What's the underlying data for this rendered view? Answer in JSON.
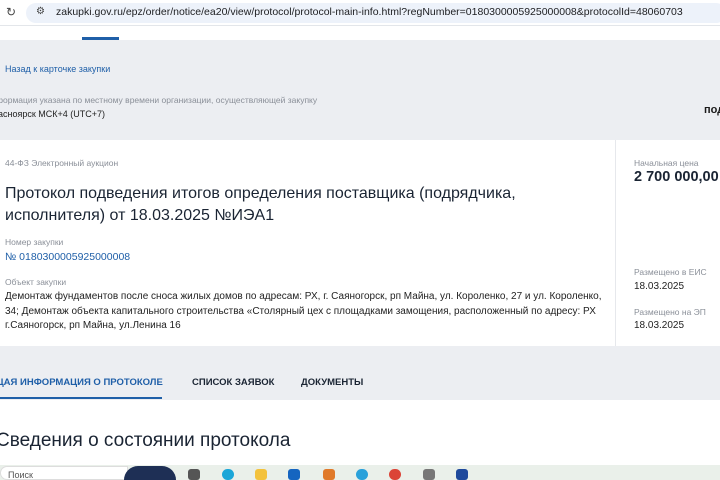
{
  "browser": {
    "url": "zakupki.gov.ru/epz/order/notice/ea20/view/protocol/protocol-main-info.html?regNumber=0180300005925000008&protocolId=48060703"
  },
  "header": {
    "back_link": "Назад к карточке закупки",
    "tz_note": "формация указана по местному времени организации, осуществляющей закупку",
    "tz": "асноярск МСК+4 (UTC+7)",
    "right_cut": "под"
  },
  "card": {
    "law": "44-ФЗ  Электронный аукцион",
    "title": "Протокол подведения итогов определения поставщика (подрядчика, исполнителя) от 18.03.2025 №ИЭА1",
    "number_label": "Номер закупки",
    "number": "№ 0180300005925000008",
    "object_label": "Объект закупки",
    "object": "Демонтаж фундаментов после сноса жилых домов по адресам: РХ, г. Саяногорск, рп Майна, ул. Короленко, 27 и ул. Короленко, 34; Демонтаж объекта капитального строительства «Столярный цех с площадками замощения, расположенный по адресу: РХ г.Саяногорск, рп Майна, ул.Ленина 16",
    "price_label": "Начальная цена",
    "price": "2 700 000,00",
    "eis_label": "Размещено в ЕИС",
    "eis_date": "18.03.2025",
    "ep_label": "Размещено на ЭП",
    "ep_date": "18.03.2025"
  },
  "tabs": [
    {
      "label": "ЩАЯ ИНФОРМАЦИЯ О ПРОТОКОЛЕ"
    },
    {
      "label": "СПИСОК ЗАЯВОК"
    },
    {
      "label": "ДОКУМЕНТЫ"
    }
  ],
  "section_title": "Сведения о состоянии протокола",
  "taskbar": {
    "search": "Поиск"
  }
}
